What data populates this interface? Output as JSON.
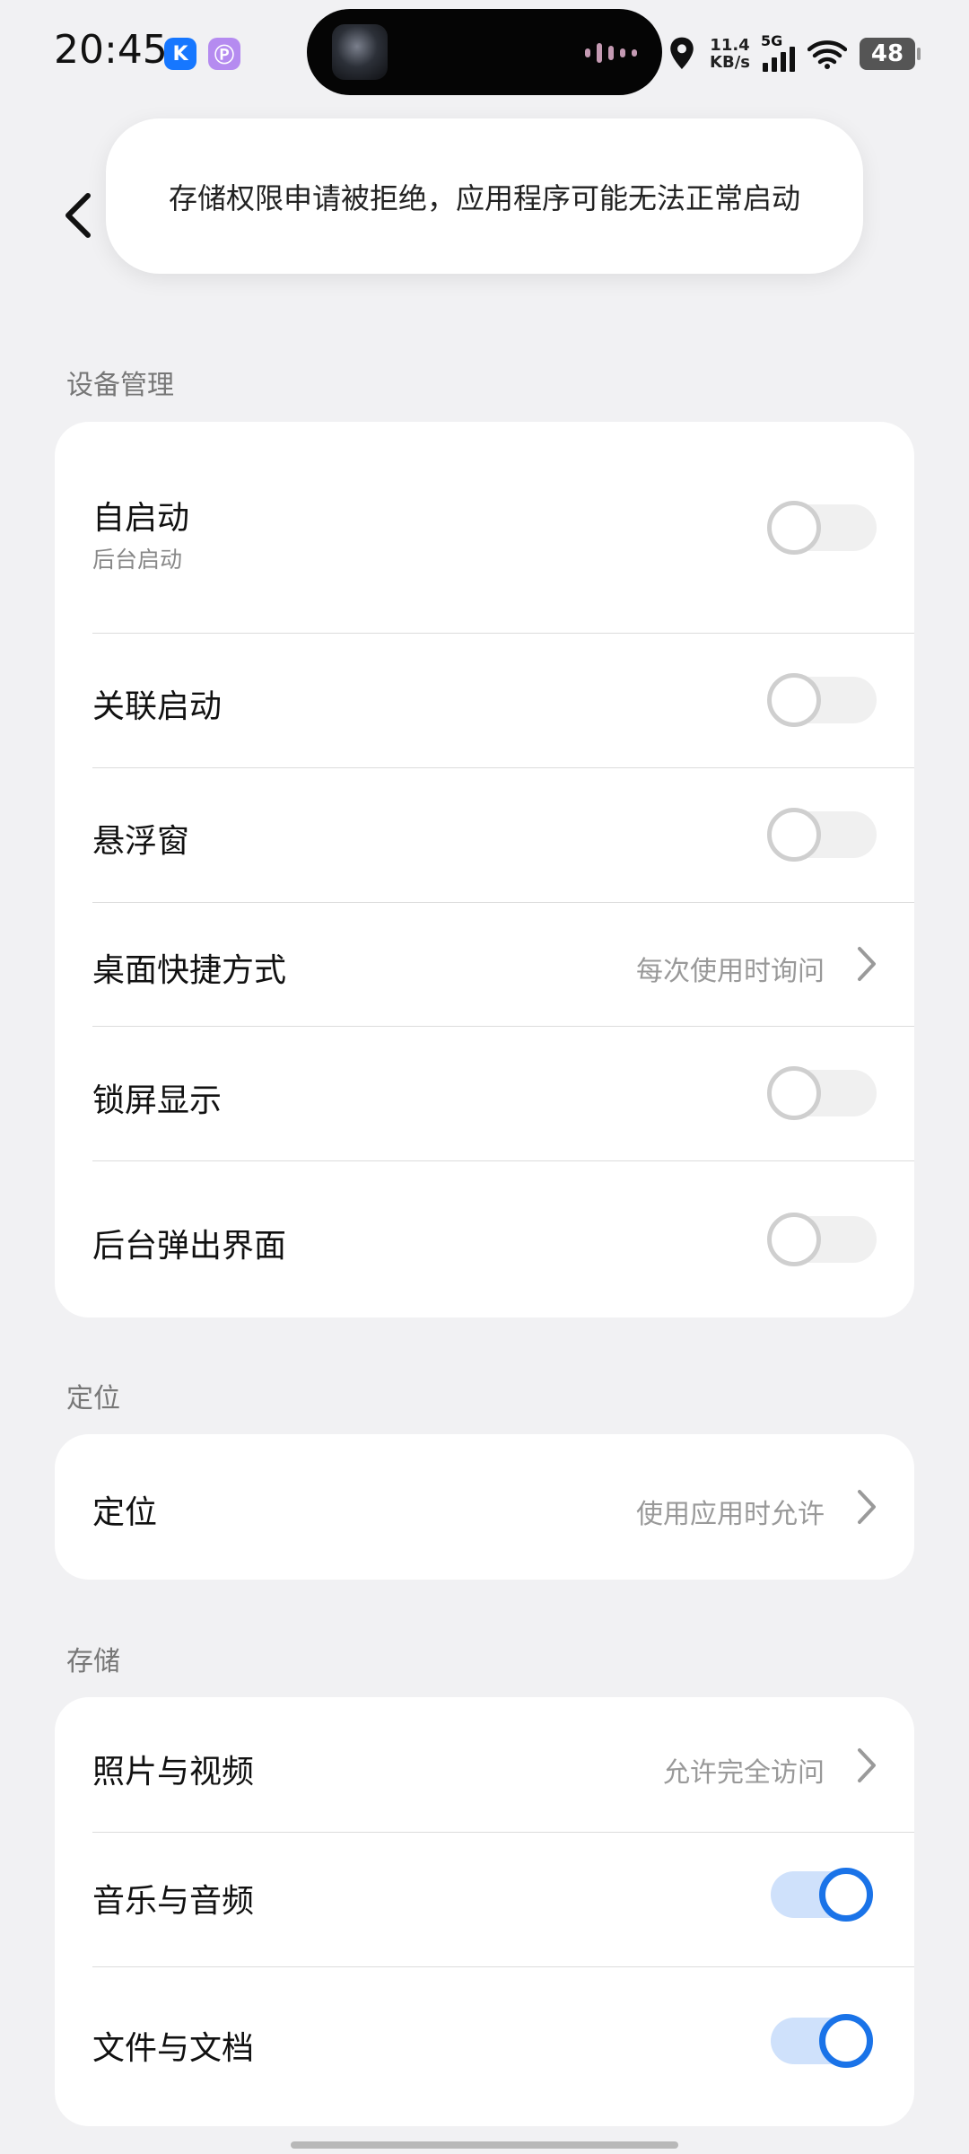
{
  "status_bar": {
    "time": "20:45",
    "badge_k": "K",
    "badge_p": "Ⓟ",
    "speed_value": "11.4",
    "speed_unit": "KB/s",
    "network": "5G",
    "battery": "48"
  },
  "toast": {
    "message": "存储权限申请被拒绝，应用程序可能无法正常启动"
  },
  "sections": {
    "device": {
      "title": "设备管理",
      "auto_start": {
        "label": "自启动",
        "sub": "后台启动",
        "enabled": false
      },
      "linked_start": {
        "label": "关联启动",
        "enabled": false
      },
      "floating_window": {
        "label": "悬浮窗",
        "enabled": false
      },
      "desktop_shortcut": {
        "label": "桌面快捷方式",
        "value": "每次使用时询问"
      },
      "lock_screen": {
        "label": "锁屏显示",
        "enabled": false
      },
      "background_popup": {
        "label": "后台弹出界面",
        "enabled": false
      }
    },
    "location": {
      "title": "定位",
      "location_row": {
        "label": "定位",
        "value": "使用应用时允许"
      }
    },
    "storage": {
      "title": "存储",
      "photos_videos": {
        "label": "照片与视频",
        "value": "允许完全访问"
      },
      "music_audio": {
        "label": "音乐与音频",
        "enabled": true
      },
      "files_docs": {
        "label": "文件与文档",
        "enabled": true
      }
    }
  },
  "colors": {
    "accent": "#1a73e8",
    "background": "#f1f1f3",
    "card": "#ffffff"
  }
}
